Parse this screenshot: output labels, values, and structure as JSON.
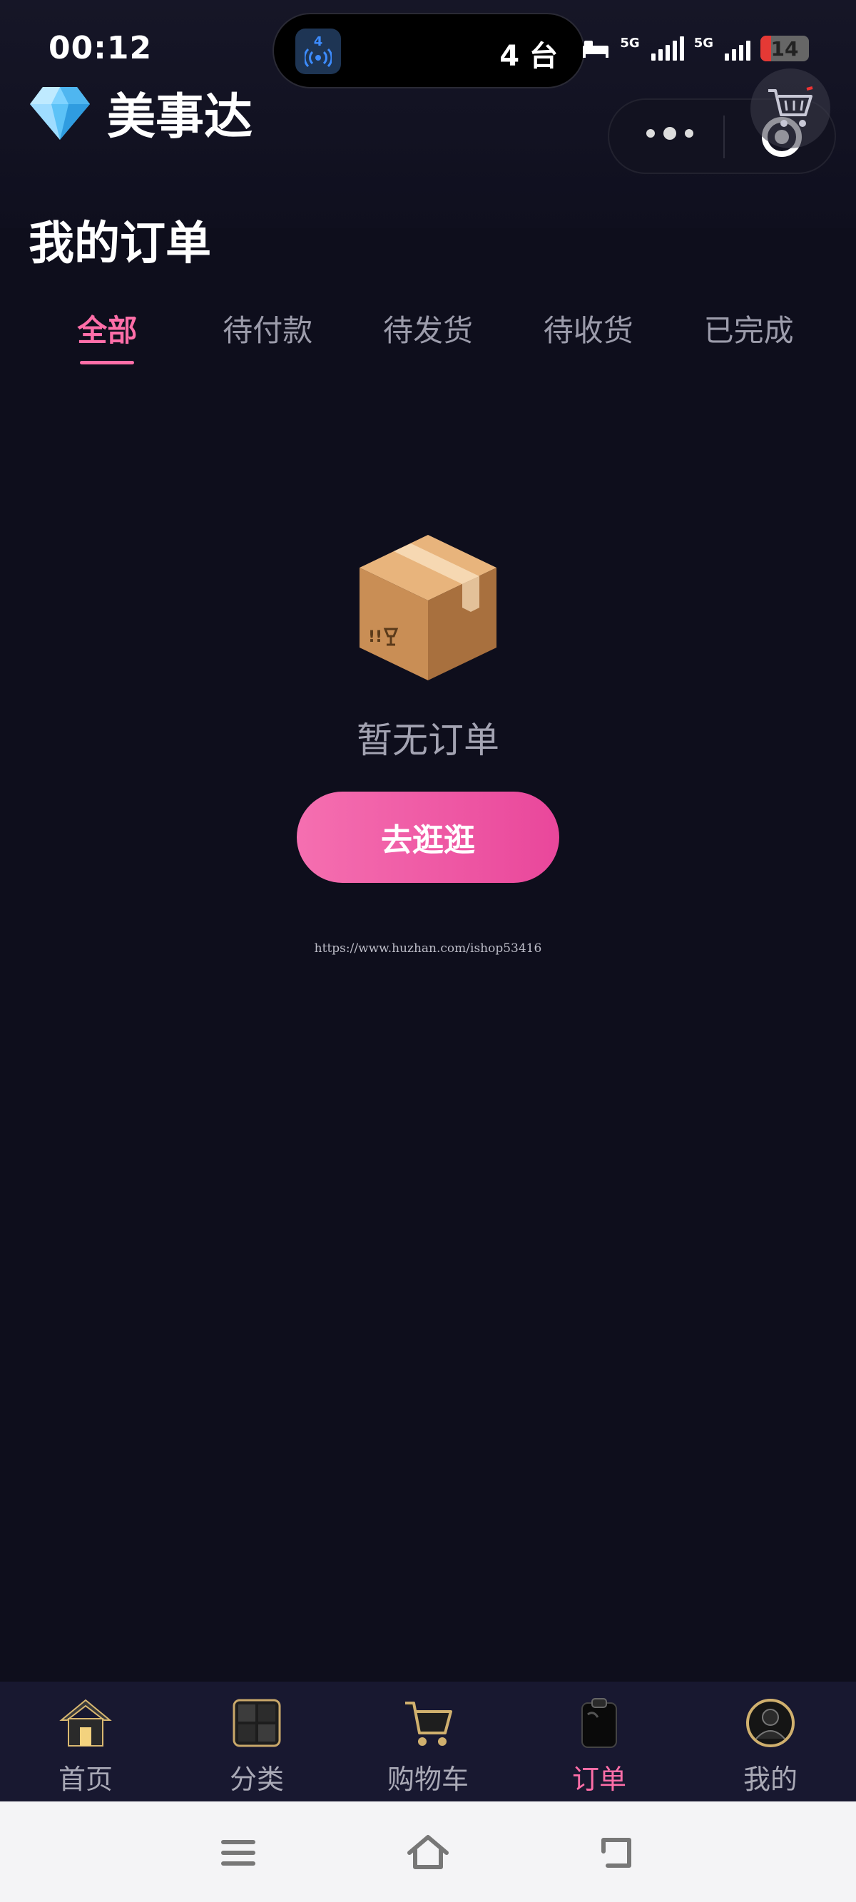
{
  "status_bar": {
    "time": "00:12",
    "island_icon_number": "4",
    "island_text": "4 台",
    "sim1_label": "5G",
    "sim2_label": "5G",
    "battery": "14",
    "battery_level": 0.14
  },
  "header": {
    "brand_name": "美事达"
  },
  "page": {
    "title": "我的订单"
  },
  "tabs": [
    {
      "label": "全部",
      "active": true
    },
    {
      "label": "待付款",
      "active": false
    },
    {
      "label": "待发货",
      "active": false
    },
    {
      "label": "待收货",
      "active": false
    },
    {
      "label": "已完成",
      "active": false
    }
  ],
  "empty_state": {
    "message": "暂无订单",
    "button_label": "去逛逛",
    "watermark_url": "https://www.huzhan.com/ishop53416"
  },
  "bottom_nav": [
    {
      "label": "首页",
      "icon": "home-icon",
      "active": false
    },
    {
      "label": "分类",
      "icon": "category-icon",
      "active": false
    },
    {
      "label": "购物车",
      "icon": "cart-icon",
      "active": false
    },
    {
      "label": "订单",
      "icon": "order-icon",
      "active": true
    },
    {
      "label": "我的",
      "icon": "profile-icon",
      "active": false
    }
  ],
  "colors": {
    "background": "#0e0e1c",
    "accent": "#ff6ea8",
    "button_gradient_start": "#f56fb0",
    "button_gradient_end": "#e9479b",
    "nav_background": "#181830"
  }
}
